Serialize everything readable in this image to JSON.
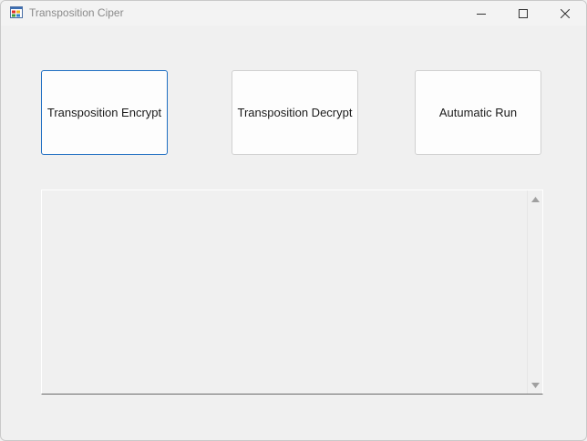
{
  "window": {
    "title": "Transposition Ciper",
    "app_icon": "winforms-app-icon",
    "controls": {
      "minimize_icon": "minimize-icon",
      "maximize_icon": "maximize-icon",
      "close_icon": "close-icon"
    }
  },
  "buttons": {
    "encrypt_label": "Transposition Encrypt",
    "decrypt_label": "Transposition Decrypt",
    "auto_run_label": "Autumatic Run"
  },
  "output": {
    "value": "",
    "scroll_up_icon": "scroll-up-arrow-icon",
    "scroll_down_icon": "scroll-down-arrow-icon"
  },
  "colors": {
    "window_background": "#f0f0f0",
    "button_background": "#fdfdfd",
    "focus_border": "#1f6fc2",
    "title_text": "#8a8a8a"
  }
}
